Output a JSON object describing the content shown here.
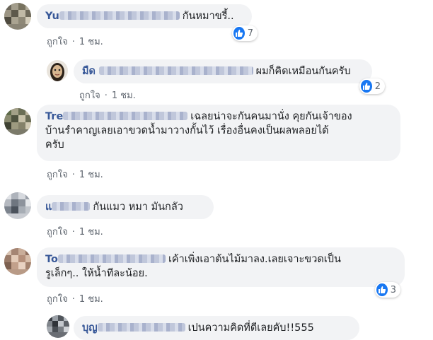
{
  "comments": [
    {
      "author": "Yu",
      "text": "กันหมาขรี้..",
      "like_label": "ถูกใจ",
      "time": "1 ชม.",
      "reactions": "7"
    },
    {
      "author": "มืด",
      "text": "ผมก็คิดเหมือนกันครับ",
      "like_label": "ถูกใจ",
      "time": "1 ชม.",
      "reactions": "2"
    },
    {
      "author": "Tre",
      "text_line1": "เฉลยน่าจะกันคนมานั่ง คุยกันเจ้าของ",
      "text_line2": "บ้านรำคาญเลยเอาขวดน้ำมาวางกั้นไว้ เรื่องอื่นคงเป็นผลพลอยได้",
      "text_line3": "ครับ",
      "like_label": "ถูกใจ",
      "time": "1 ชม."
    },
    {
      "author": "แ",
      "text": "กันแมว หมา มันกลัว",
      "like_label": "ถูกใจ",
      "time": "1 ชม."
    },
    {
      "author": "To",
      "text_line1": "เค้าเพิ่งเอาต้นไม้มาลง.เลยเจาะขวดเป็น",
      "text_line2": "รูเล็กๆ.. ให้น้ำทีละน้อย.",
      "like_label": "ถูกใจ",
      "time": "1 ชม.",
      "reactions": "3"
    },
    {
      "author": "บุญ",
      "text": "เปนความคิดที่ดีเลยคับ!!555"
    }
  ],
  "separator": "·",
  "icons": {
    "reaction": "like-icon",
    "avatar": "avatar"
  },
  "colors": {
    "author": "#385898",
    "bubble": "#f2f3f5",
    "like_blue": "#1877f2",
    "meta": "#606770"
  }
}
